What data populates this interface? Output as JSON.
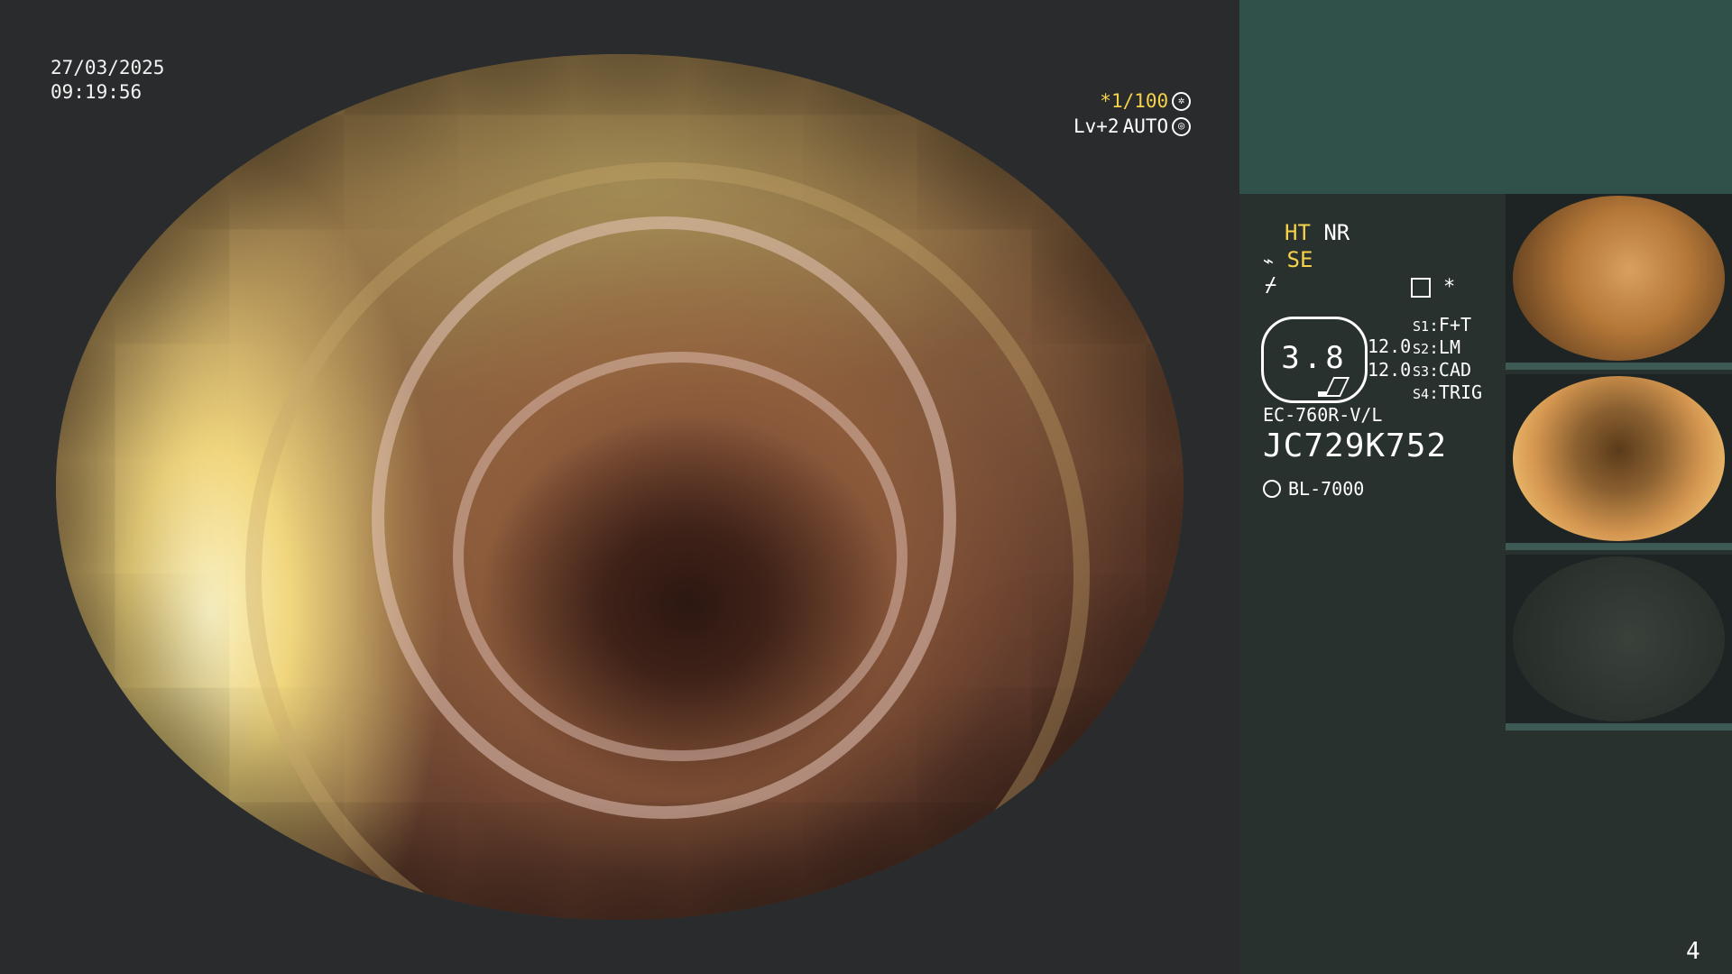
{
  "overlay": {
    "date": "27/03/2025",
    "time": "09:19:56",
    "shutter": "*1/100",
    "level": "Lv+2",
    "iris": "AUTO"
  },
  "settings": {
    "ht": "HT",
    "nr": "NR",
    "se": "SE",
    "gauge_value": "3.8",
    "value_a": "12.0",
    "value_b": "12.0",
    "star": "*",
    "switches": [
      {
        "key": "S1",
        "value": "F+T"
      },
      {
        "key": "S2",
        "value": "LM"
      },
      {
        "key": "S3",
        "value": "CAD"
      },
      {
        "key": "S4",
        "value": "TRIG"
      }
    ],
    "scope_model": "EC-760R-V/L",
    "serial": "JC729K752",
    "light_source": "BL-7000"
  },
  "page_number": "4",
  "colors": {
    "background": "#2a2b2c",
    "panel_top": "#30504a",
    "panel_main": "#29312f",
    "accent_yellow": "#f5d24a"
  }
}
